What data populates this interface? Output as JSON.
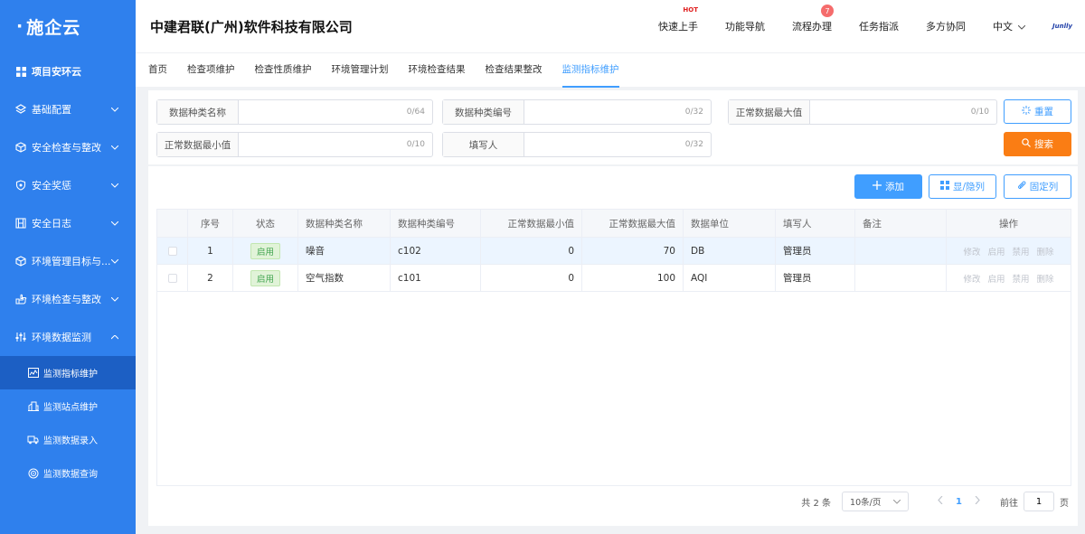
{
  "app": {
    "logo": "施企云",
    "company": "中建君联(广州)软件科技有限公司"
  },
  "topnav": {
    "quick_start": "快速上手",
    "hot_label": "HOT",
    "function_nav": "功能导航",
    "process": "流程办理",
    "process_badge": "7",
    "task_assign": "任务指派",
    "collab": "多方协同",
    "language": "中文",
    "brand_mark": "Junlly"
  },
  "sidebar": {
    "items": [
      {
        "label": "项目安环云",
        "icon": "grid-icon"
      },
      {
        "label": "基础配置",
        "icon": "layers-icon"
      },
      {
        "label": "安全检查与整改",
        "icon": "cube-icon"
      },
      {
        "label": "安全奖惩",
        "icon": "shield-icon"
      },
      {
        "label": "安全日志",
        "icon": "film-icon"
      },
      {
        "label": "环境管理目标与...",
        "icon": "cube-icon"
      },
      {
        "label": "环境检查与整改",
        "icon": "hand-icon"
      },
      {
        "label": "环境数据监测",
        "icon": "sliders-icon"
      }
    ],
    "subitems": [
      {
        "label": "监测指标维护",
        "icon": "chart-icon"
      },
      {
        "label": "监测站点维护",
        "icon": "building-icon"
      },
      {
        "label": "监测数据录入",
        "icon": "truck-icon"
      },
      {
        "label": "监测数据查询",
        "icon": "target-icon"
      }
    ]
  },
  "tabs": [
    "首页",
    "检查项维护",
    "检查性质维护",
    "环境管理计划",
    "环境检查结果",
    "检查结果整改",
    "监测指标维护"
  ],
  "search": {
    "fields": [
      {
        "label": "数据种类名称",
        "count": "0/64"
      },
      {
        "label": "数据种类编号",
        "count": "0/32"
      },
      {
        "label": "正常数据最大值",
        "count": "0/10"
      },
      {
        "label": "正常数据最小值",
        "count": "0/10"
      },
      {
        "label": "填写人",
        "count": "0/32"
      }
    ],
    "reset_label": "重置",
    "search_label": "搜索"
  },
  "toolbar": {
    "add_label": "添加",
    "toggle_cols_label": "显/隐列",
    "fix_cols_label": "固定列"
  },
  "table": {
    "headers": [
      "序号",
      "状态",
      "数据种类名称",
      "数据种类编号",
      "正常数据最小值",
      "正常数据最大值",
      "数据单位",
      "填写人",
      "备注",
      "操作"
    ],
    "rows": [
      {
        "no": "1",
        "status": "启用",
        "name": "噪音",
        "code": "c102",
        "min": "0",
        "max": "70",
        "unit": "DB",
        "writer": "管理员",
        "remark": ""
      },
      {
        "no": "2",
        "status": "启用",
        "name": "空气指数",
        "code": "c101",
        "min": "0",
        "max": "100",
        "unit": "AQI",
        "writer": "管理员",
        "remark": ""
      }
    ],
    "ops": [
      "修改",
      "启用",
      "禁用",
      "删除"
    ]
  },
  "pager": {
    "total": "共 2 条",
    "page_size": "10条/页",
    "current_page": "1",
    "goto_prefix": "前往",
    "goto_value": "1",
    "goto_suffix": "页"
  },
  "colors": {
    "sidebar": "#2f80ed",
    "primary": "#409eff",
    "orange": "#fa7d14",
    "status_green": "#3fa34d"
  }
}
